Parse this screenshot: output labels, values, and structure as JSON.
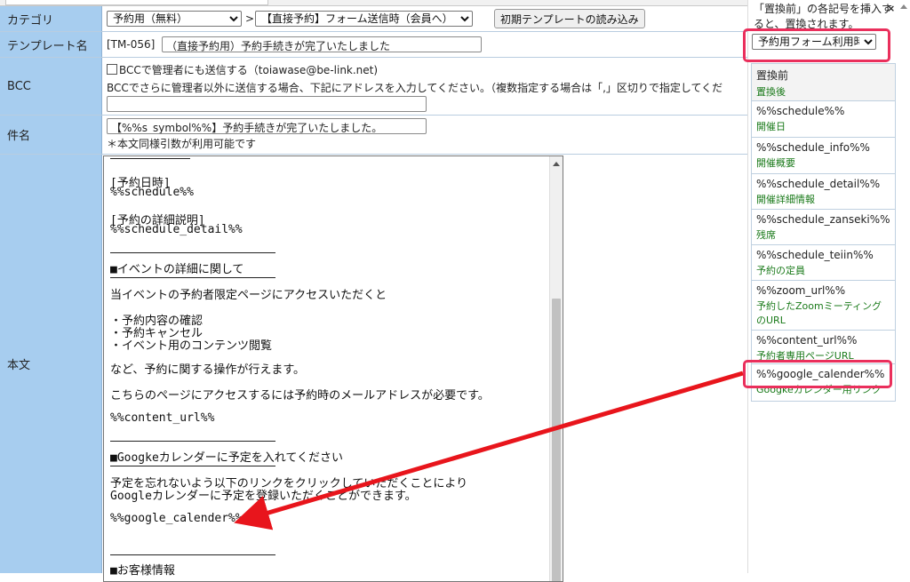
{
  "form": {
    "category": {
      "label": "カテゴリ",
      "select1": "予約用（無料）",
      "separator": ">",
      "select2": "【直接予約】フォーム送信時（会員へ）",
      "load_button": "初期テンプレートの読み込み"
    },
    "template_name": {
      "label": "テンプレート名",
      "code": "[TM-056]",
      "value": "（直接予約用）予約手続きが完了いたしました"
    },
    "bcc": {
      "label": "BCC",
      "checkbox_label": "BCCで管理者にも送信する（toiawase@be-link.net)",
      "note": "BCCでさらに管理者以外に送信する場合、下記にアドレスを入力してください。（複数指定する場合は「,」区切りで指定してくだ",
      "value": ""
    },
    "subject": {
      "label": "件名",
      "value": "【%%s_symbol%%】予約手続きが完了いたしました。",
      "note": "＊本文同様引数が利用可能です"
    },
    "body": {
      "label": "本文",
      "lines": [
        "[予約日時]",
        "%%schedule%%",
        "[予約の詳細説明]",
        "%%schedule_detail%%",
        "■イベントの詳細に関して",
        "当イベントの予約者限定ページにアクセスいただくと",
        "・予約内容の確認",
        "・予約キャンセル",
        "・イベント用のコンテンツ閲覧",
        "など、予約に関する操作が行えます。",
        "こちらのページにアクセスするには予約時のメールアドレスが必要です。",
        "%%content_url%%",
        "■Googkeカレンダーに予定を入れてください",
        "予定を忘れないよう以下のリンクをクリックしていただくことにより",
        "Googleカレンダーに予定を登録いただくことができます。",
        "%%google_calender%%",
        "■お客様情報"
      ]
    }
  },
  "panel": {
    "hint": "「置換前」の各記号を挿入すると、置換されます。",
    "close": "×",
    "select": "予約用フォーム利用時",
    "header": {
      "code": "置換前",
      "desc": "置換後"
    },
    "items": [
      {
        "code": "%%schedule%%",
        "desc": "開催日"
      },
      {
        "code": "%%schedule_info%%",
        "desc": "開催概要"
      },
      {
        "code": "%%schedule_detail%%",
        "desc": "開催詳細情報"
      },
      {
        "code": "%%schedule_zanseki%%",
        "desc": "残席"
      },
      {
        "code": "%%schedule_teiin%%",
        "desc": "予約の定員"
      },
      {
        "code": "%%zoom_url%%",
        "desc": "予約したZoomミーティングのURL"
      },
      {
        "code": "%%content_url%%",
        "desc": "予約者専用ページURL"
      },
      {
        "code": "%%google_calender%%",
        "desc": "Googkeカレンダー用リンク"
      }
    ]
  },
  "colors": {
    "label_bg": "#a7cdef",
    "highlight": "#ea2f5c",
    "arrow": "#e8151c",
    "desc_text": "#1a7a1a"
  }
}
